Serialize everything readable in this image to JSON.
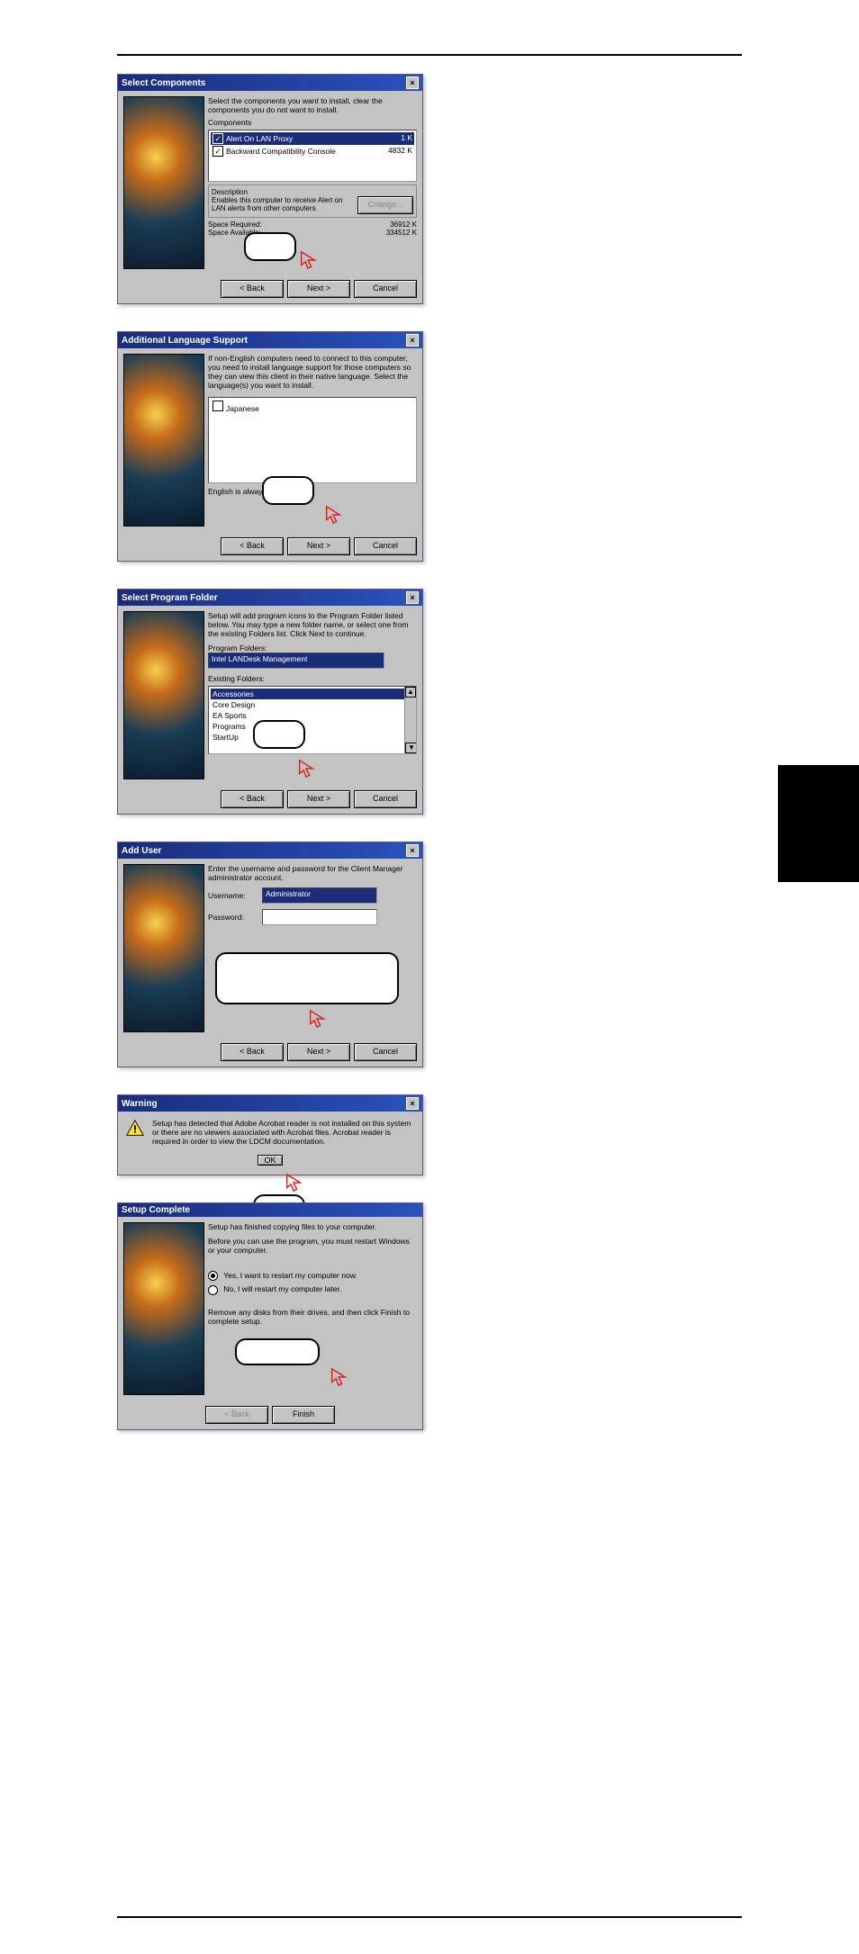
{
  "dialogs": {
    "select_components": {
      "title": "Select Components",
      "instruction": "Select the components you want to install, clear the components you do not want to install.",
      "label_components": "Components",
      "items": [
        {
          "name": "Alert On LAN Proxy",
          "size": "1 K",
          "checked": true,
          "selected": true
        },
        {
          "name": "Backward Compatibility Console",
          "size": "4832 K",
          "checked": true,
          "selected": false
        }
      ],
      "desc_heading": "Description",
      "desc_text": "Enables this computer to receive Alert on LAN alerts from other computers.",
      "change_btn": "Change...",
      "space_required_label": "Space Required:",
      "space_required_value": "36912 K",
      "space_available_label": "Space Available:",
      "space_available_value": "334512 K",
      "back": "< Back",
      "next": "Next >",
      "cancel": "Cancel"
    },
    "additional_language": {
      "title": "Additional Language Support",
      "instruction": "If non-English computers need to connect to this computer, you need to install language support for those computers so they can view this client in their native language. Select the language(s) you want to install.",
      "items": [
        "Japanese"
      ],
      "footnote": "English is always installed.",
      "back": "< Back",
      "next": "Next >",
      "cancel": "Cancel"
    },
    "select_program_folder": {
      "title": "Select Program Folder",
      "instruction": "Setup will add program icons to the Program Folder listed below. You may type a new folder name, or select one from the existing Folders list. Click Next to continue.",
      "label_program_folders": "Program Folders:",
      "program_folder_value": "Intel LANDesk Management",
      "label_existing": "Existing Folders:",
      "existing": [
        "Accessories",
        "Core Design",
        "EA Sports",
        "Programs",
        "StartUp"
      ],
      "back": "< Back",
      "next": "Next >",
      "cancel": "Cancel"
    },
    "add_user": {
      "title": "Add User",
      "instruction": "Enter the username and password for the Client Manager administrator account.",
      "label_username": "Username:",
      "username_value": "Administrator",
      "label_password": "Password:",
      "password_value": "",
      "back": "< Back",
      "next": "Next >",
      "cancel": "Cancel"
    },
    "warning": {
      "title": "Warning",
      "text": "Setup has detected that Adobe Acrobat reader is not installed on this system or there are no viewers associated with Acrobat files. Acrobat reader is required in order to view the LDCM documentation.",
      "ok": "OK"
    },
    "setup_complete": {
      "title": "Setup Complete",
      "line1": "Setup has finished copying files to your computer.",
      "line2": "Before you can use the program, you must restart Windows or your computer.",
      "opt_yes": "Yes, I want to restart my computer now.",
      "opt_no": "No, I will restart my computer later.",
      "line3_a": "Remove any disks from their drives, and then click Finish to",
      "line3_b": "complete setup.",
      "back": "< Back",
      "finish": "Finish"
    }
  }
}
